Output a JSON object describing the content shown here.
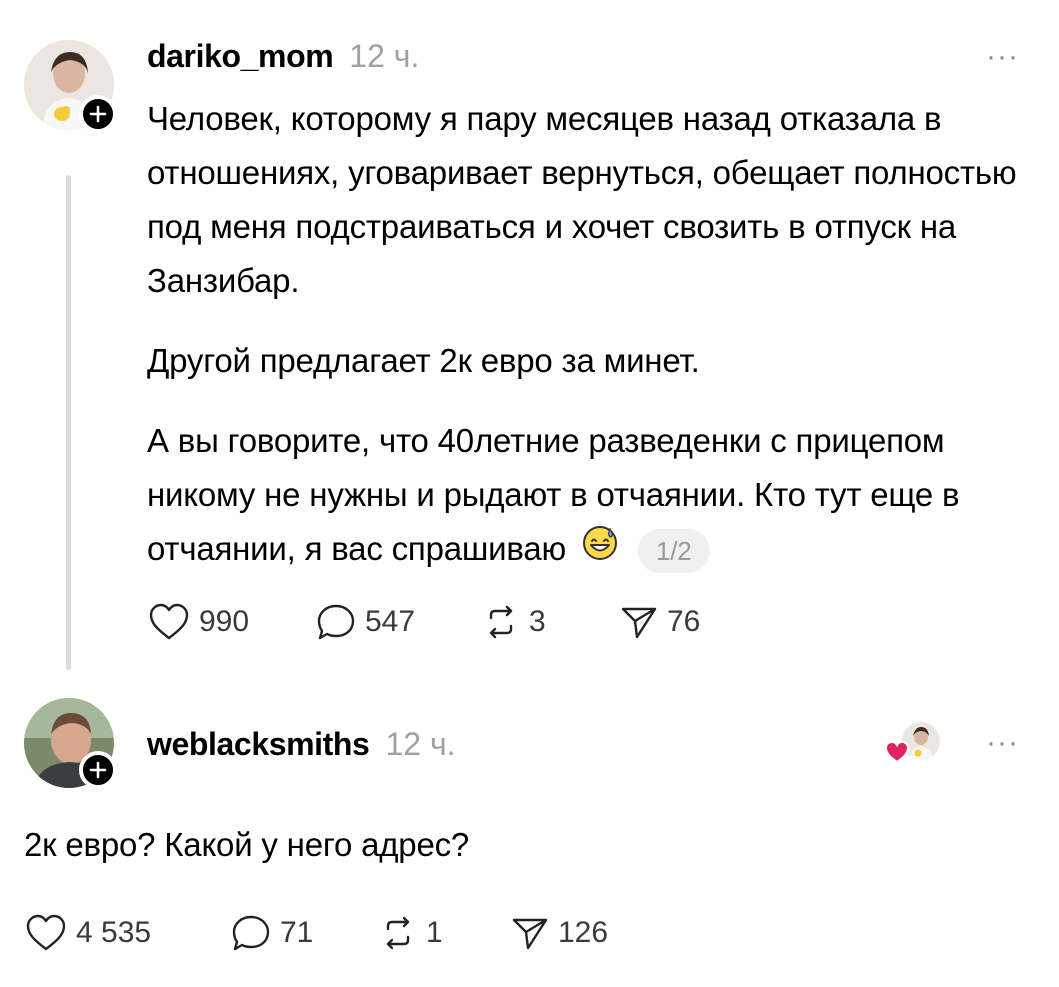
{
  "post": {
    "username": "dariko_mom",
    "time": "12 ч.",
    "more_label": "···",
    "paragraphs": [
      "Человек, которому я пару месяцев назад отказала в отношениях, уговаривает вернуться, обещает полностью под меня подстраиваться и хочет свозить в отпуск на Занзибар.",
      "Другой предлагает 2к евро за минет.",
      "А вы говорите, что 40летние разведенки с прицепом никому не нужны и рыдают в отчаянии. Кто тут еще в отчаянии, я вас спрашиваю"
    ],
    "emoji": "grinning-sweat-emoji",
    "page_counter": "1/2",
    "stats": {
      "likes": "990",
      "comments": "547",
      "reposts": "3",
      "shares": "76"
    }
  },
  "reply": {
    "username": "weblacksmiths",
    "time": "12 ч.",
    "more_label": "···",
    "text": "2к евро? Какой у него адрес?",
    "stats": {
      "likes": "4 535",
      "comments": "71",
      "reposts": "1",
      "shares": "126"
    }
  },
  "icons": {
    "like": "heart-outline-icon",
    "comment": "speech-bubble-icon",
    "repost": "repost-icon",
    "share": "paper-plane-icon",
    "follow": "plus-icon",
    "liked_by_author": "red-heart-icon"
  },
  "colors": {
    "text": "#000000",
    "muted": "#a0a0a0",
    "line": "#dcdcdc",
    "like_red": "#e0245e"
  }
}
